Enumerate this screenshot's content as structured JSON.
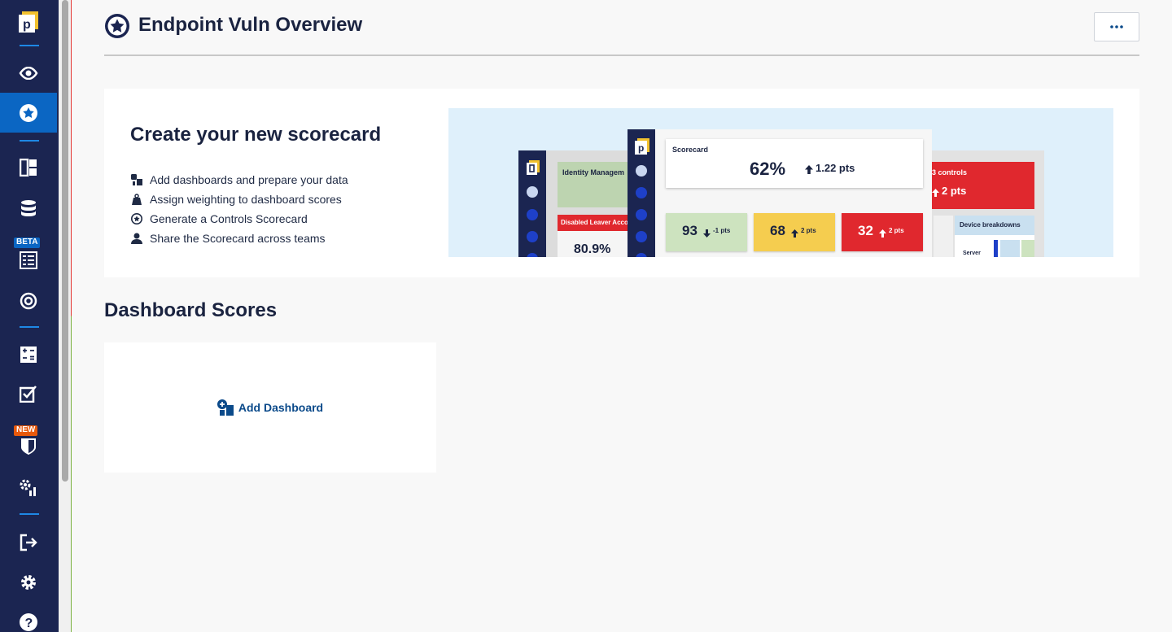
{
  "app": {
    "page_title": "Endpoint Vuln Overview",
    "more_label": "•••"
  },
  "sidebar": {
    "items": [
      {
        "icon": "logo-icon"
      },
      {
        "icon": "eye-icon"
      },
      {
        "icon": "star-circle-icon",
        "active": true
      },
      {
        "icon": "dashboard-layout-icon"
      },
      {
        "icon": "database-icon"
      },
      {
        "icon": "checklist-icon",
        "badge": "BETA"
      },
      {
        "icon": "target-icon"
      },
      {
        "icon": "calculator-icon"
      },
      {
        "icon": "checkbox-icon"
      },
      {
        "icon": "shield-icon",
        "badge": "NEW"
      },
      {
        "icon": "settings-chart-icon"
      },
      {
        "icon": "logout-icon"
      },
      {
        "icon": "gear-icon"
      },
      {
        "icon": "help-icon"
      }
    ],
    "beta_badge": "BETA",
    "new_badge": "NEW",
    "logo_letter": "p"
  },
  "create_card": {
    "title": "Create your new scorecard",
    "steps": [
      {
        "icon": "dashboard-add-icon",
        "label": "Add dashboards and prepare your data"
      },
      {
        "icon": "weight-icon",
        "label": "Assign weighting to dashboard scores"
      },
      {
        "icon": "star-circle-icon",
        "label": "Generate a Controls Scorecard"
      },
      {
        "icon": "person-icon",
        "label": "Share the Scorecard across teams"
      }
    ]
  },
  "preview": {
    "logo_letter": "p",
    "identity_label": "Identity Managem",
    "disabled_label": "Disabled Leaver Acco",
    "disabled_value": "80.9%",
    "scorecard_label": "Scorecard",
    "scorecard_value": "62%",
    "scorecard_delta": "1.22 pts",
    "tiles": [
      {
        "value": "93",
        "delta": "-1 pts",
        "color": "#cde3bf",
        "text_color": "#1a2340"
      },
      {
        "value": "68",
        "delta": "2 pts",
        "color": "#f5cd4f",
        "text_color": "#1a2340"
      },
      {
        "value": "32",
        "delta": "2 pts",
        "color": "#e0282e",
        "text_color": "#ffffff"
      }
    ],
    "controls_label": "3 controls",
    "controls_delta": "2 pts",
    "device_label": "Device breakdowns",
    "server_label": "Server"
  },
  "scores": {
    "title": "Dashboard Scores",
    "add_label": "Add Dashboard"
  },
  "colors": {
    "sidebar_bg": "#1b2551",
    "active": "#0b66c3",
    "accent": "#1e88e5",
    "beta_badge": "#0b66c3",
    "new_badge": "#e8590c",
    "link": "#0b4a8a"
  }
}
